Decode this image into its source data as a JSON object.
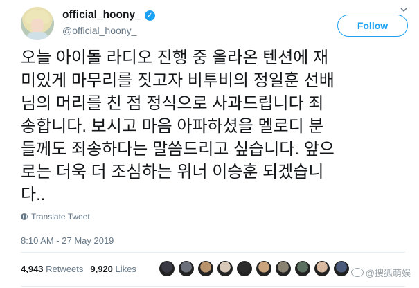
{
  "header": {
    "display_name": "official_hoony_",
    "handle": "@official_hoony_",
    "follow_label": "Follow",
    "verified_icon": "✓"
  },
  "tweet": {
    "lines": [
      "오늘 아이돌 라디오 진행 중 올라온 텐션에 재",
      "미있게 마무리를 짓고자 비투비의 정일훈 선배",
      "님의 머리를 친 점 정식으로 사과드립니다 죄",
      "송합니다. 보시고 마음 아파하셨을 멜로디 분",
      "들께도 죄송하다는 말씀드리고 싶습니다. 앞으",
      "로는 더욱 더 조심하는 위너 이승훈 되겠습니",
      "다.."
    ],
    "translate_label": "Translate Tweet",
    "timestamp": "8:10 AM - 27 May 2019"
  },
  "stats": {
    "retweets_count": "4,943",
    "retweets_label": "Retweets",
    "likes_count": "9,920",
    "likes_label": "Likes"
  },
  "likers": {
    "colors": [
      "#3a3a44",
      "#6b6f7a",
      "#b8926a",
      "#d8c8b8",
      "#2b2b2b",
      "#c9a47c",
      "#8a8270",
      "#5a6f5f",
      "#d9b9a0",
      "#4a5a7a"
    ]
  },
  "watermark": {
    "text": "@搜狐萌娱"
  },
  "colors": {
    "accent": "#1da1f2",
    "text": "#14171a",
    "muted": "#657786"
  }
}
